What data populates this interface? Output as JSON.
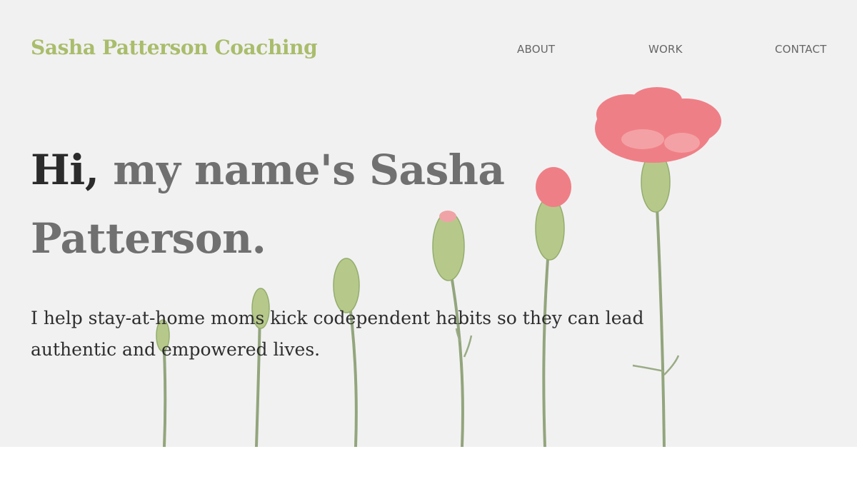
{
  "header": {
    "brand": "Sasha Patterson Coaching",
    "nav": [
      {
        "label": "ABOUT"
      },
      {
        "label": "WORK"
      },
      {
        "label": "CONTACT"
      }
    ]
  },
  "hero": {
    "greeting": "Hi,",
    "headline_rest": " my name's Sasha Patterson.",
    "tagline": "I help stay-at-home moms kick codependent habits so they can lead authentic and empowered lives.",
    "background_image": "carnation-flowers-growing-sequence"
  },
  "colors": {
    "brand": "#a9bd6b",
    "hero_bg": "#f1f1f2",
    "headline_accent": "#2b2b2b",
    "headline": "#707070",
    "nav_text": "#666666",
    "petal": "#ef7a80",
    "stem": "#8aa070"
  }
}
